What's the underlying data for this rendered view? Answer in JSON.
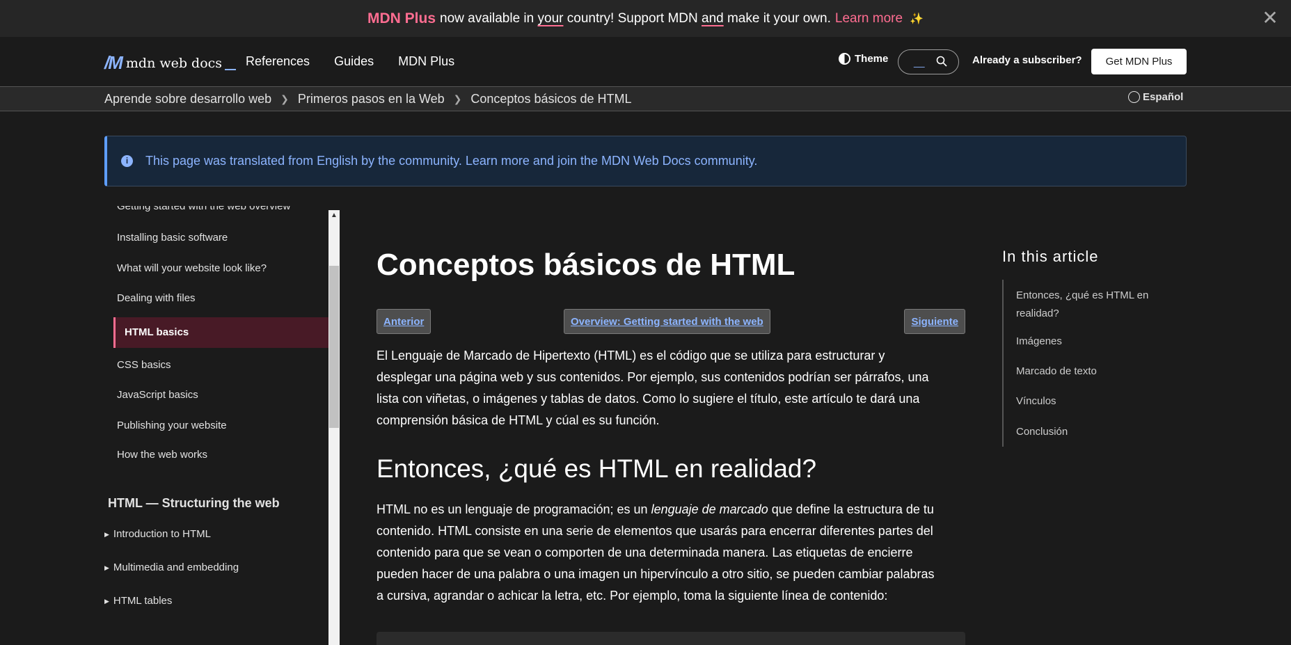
{
  "banner": {
    "brand": "MDN Plus",
    "text_a": "now available in",
    "text_your": "your",
    "text_b": "country! Support MDN",
    "text_and": "and",
    "text_c": "make it your own.",
    "learn_more": "Learn more",
    "sparkle": "✨",
    "close": "✕"
  },
  "header": {
    "logo_text": "mdn web docs",
    "nav": [
      "References",
      "Guides",
      "MDN Plus"
    ],
    "theme_label": "Theme",
    "already_subscriber": "Already a subscriber?",
    "get_plus": "Get MDN Plus"
  },
  "breadcrumb": {
    "items": [
      "Aprende sobre desarrollo web",
      "Primeros pasos en la Web",
      "Conceptos básicos de HTML"
    ],
    "language": "Español"
  },
  "notice": {
    "message": "This page was translated from English by the community. Learn more and join the MDN Web Docs community."
  },
  "sidebar": {
    "top_partial": "Getting started with the web overview",
    "items": [
      "Installing basic software",
      "What will your website look like?",
      "Dealing with files"
    ],
    "active": "HTML basics",
    "items_after": [
      "CSS basics",
      "JavaScript basics",
      "Publishing your website",
      "How the web works"
    ],
    "section_heading": "HTML — Structuring the web",
    "expandable": [
      "Introduction to HTML",
      "Multimedia and embedding",
      "HTML tables"
    ]
  },
  "article": {
    "title": "Conceptos básicos de HTML",
    "prev": "Anterior",
    "overview": "Overview: Getting started with the web",
    "next": "Siguiente",
    "intro_lines": [
      "El Lenguaje de Marcado de Hipertexto (HTML) es el código que se utiliza para estructurar y",
      "desplegar una página web y sus contenidos. Por ejemplo, sus contenidos podrían ser párrafos, una",
      "lista con viñetas, o imágenes y tablas de datos. Como lo sugiere el título, este artículo te dará una",
      "comprensión básica de HTML y cúal es su función."
    ],
    "h2": "Entonces, ¿qué es HTML en realidad?",
    "p2_line1_a": "HTML no es un lenguaje de programación; es un",
    "p2_line1_em": "lenguaje de marcado",
    "p2_line1_b": "que define la estructura de tu",
    "p2_lines": [
      "contenido. HTML consiste en una serie de elementos que usarás para encerrar diferentes partes del",
      "contenido para que se vean o comporten de una determinada manera. Las etiquetas de encierre",
      "pueden hacer de una palabra o una imagen un hipervínculo a otro sitio, se pueden cambiar palabras",
      "a cursiva, agrandar o achicar la letra, etc. Por ejemplo, toma la siguiente línea de contenido:"
    ]
  },
  "toc": {
    "title": "In this article",
    "items": [
      "Entonces, ¿qué es HTML en realidad?",
      "Imágenes",
      "Marcado de texto",
      "Vínculos",
      "Conclusión"
    ]
  }
}
